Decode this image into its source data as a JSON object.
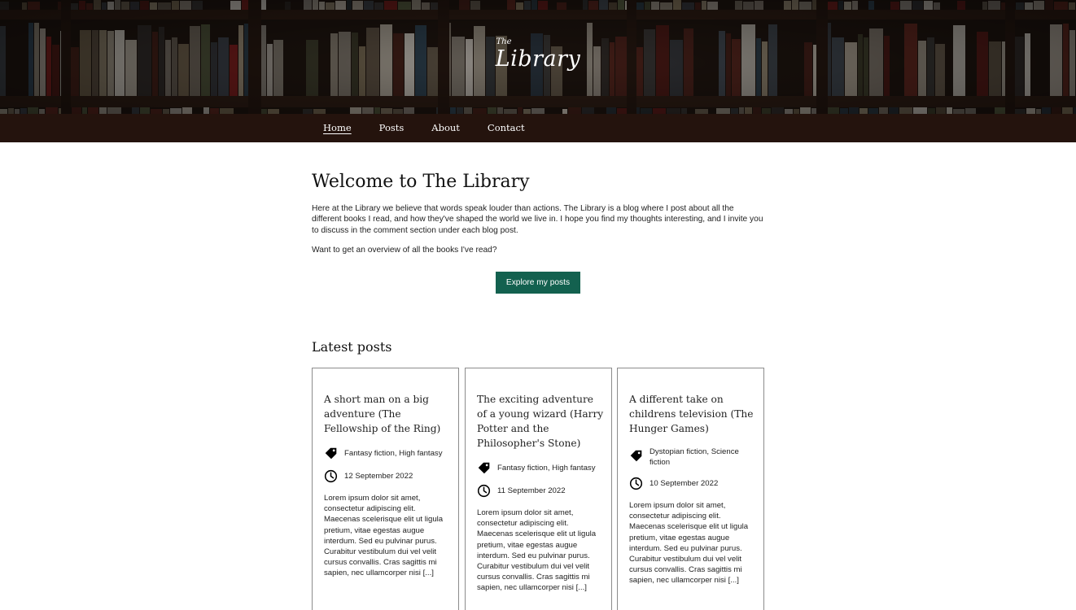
{
  "header": {
    "logo_small": "The",
    "logo_main": "Library"
  },
  "nav": {
    "items": [
      {
        "label": "Home",
        "active": true
      },
      {
        "label": "Posts",
        "active": false
      },
      {
        "label": "About",
        "active": false
      },
      {
        "label": "Contact",
        "active": false
      }
    ]
  },
  "welcome": {
    "title": "Welcome to The Library",
    "intro": "Here at the Library we believe that words speak louder than actions. The Library is a blog where I post about all the different books I read, and how they've shaped the world we live in. I hope you find my thoughts interesting, and I invite you to discuss in the comment section under each blog post.",
    "overview_question": "Want to get an overview of all the books I've read?",
    "cta_label": "Explore my posts"
  },
  "latest": {
    "title": "Latest posts",
    "posts": [
      {
        "title": "A short man on a big adventure (The Fellowship of the Ring)",
        "tags": "Fantasy fiction, High fantasy",
        "date": "12 September 2022",
        "excerpt": "Lorem ipsum dolor sit amet, consectetur adipiscing elit. Maecenas scelerisque elit ut ligula pretium, vitae egestas augue interdum. Sed eu pulvinar purus. Curabitur vestibulum dui vel velit cursus convallis. Cras sagittis mi sapien, nec ullamcorper nisi [...]"
      },
      {
        "title": "The exciting adventure of a young wizard (Harry Potter and the Philosopher's Stone)",
        "tags": "Fantasy fiction, High fantasy",
        "date": "11 September 2022",
        "excerpt": "Lorem ipsum dolor sit amet, consectetur adipiscing elit. Maecenas scelerisque elit ut ligula pretium, vitae egestas augue interdum. Sed eu pulvinar purus. Curabitur vestibulum dui vel velit cursus convallis. Cras sagittis mi sapien, nec ullamcorper nisi [...]"
      },
      {
        "title": "A different take on childrens television (The Hunger Games)",
        "tags": "Dystopian fiction, Science fiction",
        "date": "10 September 2022",
        "excerpt": "Lorem ipsum dolor sit amet, consectetur adipiscing elit. Maecenas scelerisque elit ut ligula pretium, vitae egestas augue interdum. Sed eu pulvinar purus. Curabitur vestibulum dui vel velit cursus convallis. Cras sagittis mi sapien, nec ullamcorper nisi [...]"
      }
    ]
  },
  "icons": {
    "tag": "tag-icon",
    "date": "clock-icon"
  },
  "colors": {
    "nav_background": "#24130d",
    "cta_background": "#13614f",
    "card_border": "#8c8c8c"
  }
}
